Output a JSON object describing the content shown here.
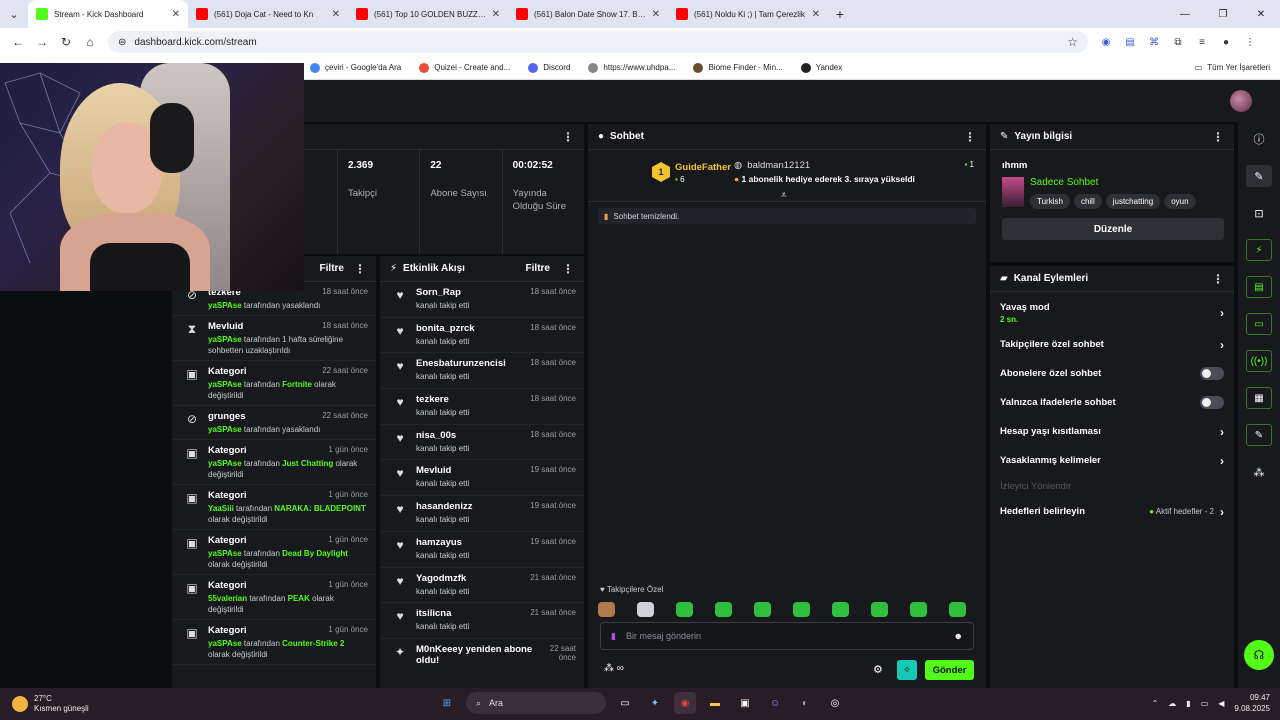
{
  "browser": {
    "tabs": [
      {
        "title": "Stream - Kick Dashboard",
        "favicon_color": "#53fc18",
        "active": true
      },
      {
        "title": "(561) Doja Cat - Need to Kn",
        "favicon_color": "#ff0000",
        "active": false
      },
      {
        "title": "(561) Top 10 GOLDEN BUZZER",
        "favicon_color": "#ff0000",
        "active": false
      },
      {
        "title": "(561) Balon Date Show 17. Bölü",
        "favicon_color": "#ff0000",
        "active": false
      },
      {
        "title": "(561) Noldu Ki ;) | Tam Çerezlik",
        "favicon_color": "#ff0000",
        "active": false
      }
    ],
    "url": "dashboard.kick.com/stream",
    "bookmarks": [
      {
        "label": "çeviri - Google'da Ara",
        "color": "#4285f4"
      },
      {
        "label": "Quizei - Create and...",
        "color": "#e84b3a"
      },
      {
        "label": "Discord",
        "color": "#5865f2"
      },
      {
        "label": "https://www.uhdpa...",
        "color": "#888888"
      },
      {
        "label": "Biome Finder - Min...",
        "color": "#6b4f2a"
      },
      {
        "label": "Yandex",
        "color": "#222222"
      }
    ],
    "bookmarks_all": "Tüm Yer İşaretleri"
  },
  "stats": [
    {
      "value": "2.369",
      "label": "Takipçi"
    },
    {
      "value": "22",
      "label": "Abone Sayısı"
    },
    {
      "value": "00:02:52",
      "label": "Yayında Olduğu Süre"
    }
  ],
  "mod_feed": {
    "filter_label": "Filtre",
    "items": [
      {
        "icon": "ban-icon",
        "glyph": "⊘",
        "name": "tezkere",
        "time": "18 saat önce",
        "actor": "yaSPAse",
        "pre": "",
        "text": " tarafından yasaklandı",
        "value": "",
        "post": ""
      },
      {
        "icon": "timeout-icon",
        "glyph": "⧗",
        "name": "Mevluid",
        "time": "18 saat önce",
        "actor": "yaSPAse",
        "pre": "",
        "text": " tarafından 1 hafta süreliğine sohbetten uzaklaştırıldı",
        "value": "",
        "post": ""
      },
      {
        "icon": "category-icon",
        "glyph": "▣",
        "name": "Kategori",
        "time": "22 saat önce",
        "actor": "yaSPAse",
        "pre": "",
        "text": " tarafından ",
        "value": "Fortnite",
        "post": " olarak değiştirildi"
      },
      {
        "icon": "ban-icon",
        "glyph": "⊘",
        "name": "grunges",
        "time": "22 saat önce",
        "actor": "yaSPAse",
        "pre": "",
        "text": " tarafından yasaklandı",
        "value": "",
        "post": ""
      },
      {
        "icon": "category-icon",
        "glyph": "▣",
        "name": "Kategori",
        "time": "1 gün önce",
        "actor": "yaSPAse",
        "pre": "",
        "text": " tarafından ",
        "value": "Just Chatting",
        "post": " olarak değiştirildi"
      },
      {
        "icon": "category-icon",
        "glyph": "▣",
        "name": "Kategori",
        "time": "1 gün önce",
        "actor": "YaaSiii",
        "pre": "",
        "text": " tarafından ",
        "value": "NARAKA: BLADEPOINT",
        "post": " olarak değiştirildi"
      },
      {
        "icon": "category-icon",
        "glyph": "▣",
        "name": "Kategori",
        "time": "1 gün önce",
        "actor": "yaSPAse",
        "pre": "",
        "text": " tarafından ",
        "value": "Dead By Daylight",
        "post": " olarak değiştirildi"
      },
      {
        "icon": "category-icon",
        "glyph": "▣",
        "name": "Kategori",
        "time": "1 gün önce",
        "actor": "55valerian",
        "pre": "",
        "text": " tarafından ",
        "value": "PEAK",
        "post": " olarak değiştirildi"
      },
      {
        "icon": "category-icon",
        "glyph": "▣",
        "name": "Kategori",
        "time": "1 gün önce",
        "actor": "yaSPAse",
        "pre": "",
        "text": " tarafından ",
        "value": "Counter-Strike 2",
        "post": " olarak değiştirildi"
      }
    ]
  },
  "activity": {
    "title": "Etkinlik Akışı",
    "filter_label": "Filtre",
    "items": [
      {
        "name": "Sorn_Rap",
        "desc": "kanalı takip etti",
        "time": "18 saat önce"
      },
      {
        "name": "bonita_pzrck",
        "desc": "kanalı takip etti",
        "time": "18 saat önce"
      },
      {
        "name": "Enesbaturunzencisi",
        "desc": "kanalı takip etti",
        "time": "18 saat önce"
      },
      {
        "name": "tezkere",
        "desc": "kanalı takip etti",
        "time": "18 saat önce"
      },
      {
        "name": "nisa_00s",
        "desc": "kanalı takip etti",
        "time": "18 saat önce"
      },
      {
        "name": "Mevluid",
        "desc": "kanalı takip etti",
        "time": "19 saat önce"
      },
      {
        "name": "hasandenizz",
        "desc": "kanalı takip etti",
        "time": "19 saat önce"
      },
      {
        "name": "hamzayus",
        "desc": "kanalı takip etti",
        "time": "19 saat önce"
      },
      {
        "name": "Yagodmzfk",
        "desc": "kanalı takip etti",
        "time": "21 saat önce"
      },
      {
        "name": "itsilicna",
        "desc": "kanalı takip etti",
        "time": "21 saat önce"
      }
    ],
    "last": {
      "name": "M0nKeeey yeniden abone oldu!",
      "time": "22 saat önce"
    }
  },
  "chat": {
    "title": "Sohbet",
    "pinned": {
      "rank": "1",
      "user": "GuideFather",
      "user_count": "6",
      "gifter": "baldman12121",
      "gift_count": "1",
      "message": "1 abonelik hediye ederek 3. sıraya yükseldi"
    },
    "system_message": "Sohbet temizlendi.",
    "followers_only_label": "Takipçilere Özel",
    "input_placeholder": "Bir mesaj gönderin",
    "send_label": "Gönder",
    "emote_color": "#2fbf3c"
  },
  "stream_info": {
    "title": "Yayın bilgisi",
    "stream_title": "ıhmm",
    "category": "Sadece Sohbet",
    "tags": [
      "Turkish",
      "chill",
      "justchatting",
      "oyun"
    ],
    "edit_label": "Düzenle"
  },
  "channel_actions": {
    "title": "Kanal Eylemleri",
    "slow_mode": {
      "label": "Yavaş mod",
      "value": "2 sn."
    },
    "followers_only": "Takipçilere özel sohbet",
    "subscribers_only": "Abonelere özel sohbet",
    "emotes_only": "Yalnızca ifadelerle sohbet",
    "age_restriction": "Hesap yaşı kısıtlaması",
    "banned_words": "Yasaklanmış kelimeler",
    "viewer_redirect": "İzleyici Yönlendir",
    "goals": {
      "label": "Hedefleri belirleyin",
      "status": "Aktif hedefler - 2"
    }
  },
  "taskbar": {
    "temp": "27°C",
    "weather": "Kısmen güneşli",
    "search": "Ara",
    "time": "09:47",
    "date": "9.08.2025"
  },
  "colors": {
    "accent": "#53fc18",
    "panel": "#18191c",
    "background": "#0b0c0e"
  }
}
